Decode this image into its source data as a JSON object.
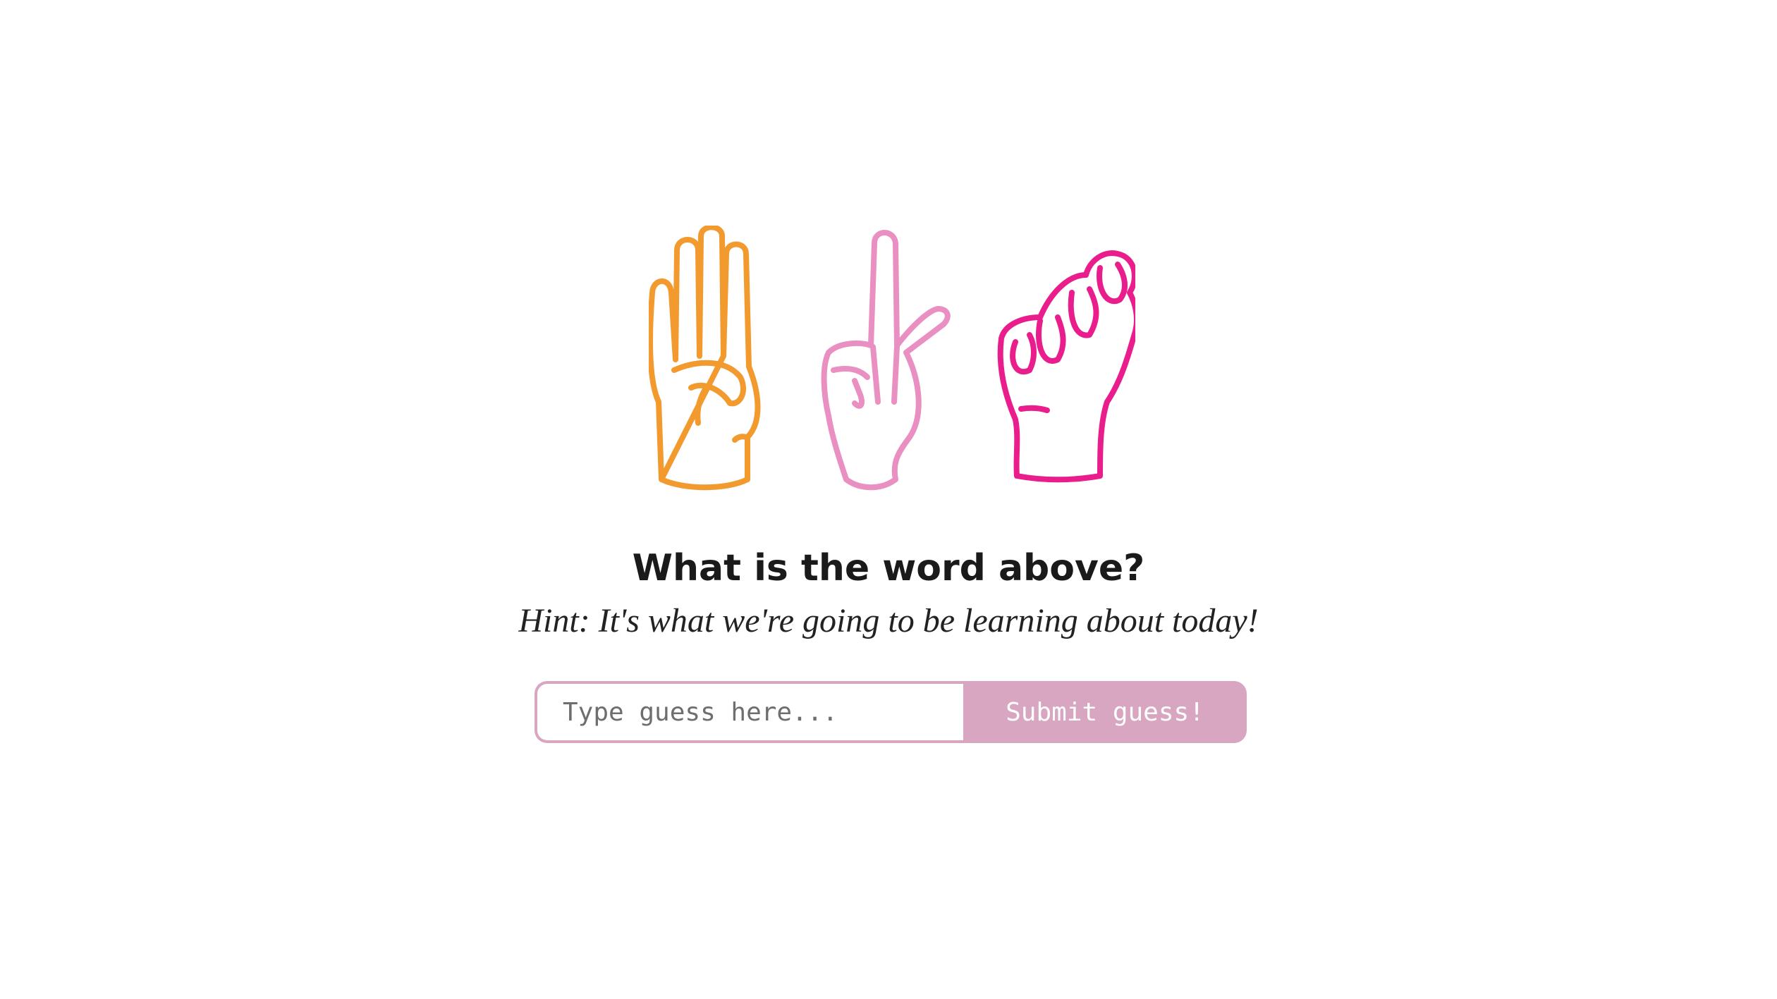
{
  "quiz": {
    "title": "What is the word above?",
    "hint": "Hint: It's what we're going to be learning about today!",
    "input_placeholder": "Type guess here...",
    "input_value": "",
    "submit_label": "Submit guess!"
  },
  "icons": {
    "hand_1": "asl-letter-b-hand-icon",
    "hand_2": "asl-letter-d-hand-icon",
    "hand_3": "asl-letter-s-hand-icon"
  },
  "colors": {
    "hand_1": "#f29a2e",
    "hand_2": "#e98fc1",
    "hand_3": "#e91e8c",
    "accent": "#d8a6c1"
  }
}
